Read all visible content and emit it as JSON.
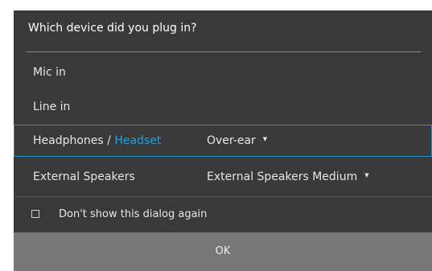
{
  "dialog": {
    "title": "Which device did you plug in?",
    "options": [
      {
        "label": "Mic in"
      },
      {
        "label": "Line in"
      },
      {
        "label_main": "Headphones / ",
        "label_accent": "Headset",
        "dropdown": "Over-ear"
      },
      {
        "label": "External Speakers",
        "dropdown": "External Speakers Medium"
      }
    ],
    "checkbox": {
      "label": "Don't show this dialog again",
      "checked": false
    },
    "ok_label": "OK"
  },
  "colors": {
    "background": "#393939",
    "accent": "#26a0e0",
    "selection_border": "#1e90c8",
    "button": "#777777"
  },
  "icons": {
    "dropdown": "caret-down-icon"
  }
}
